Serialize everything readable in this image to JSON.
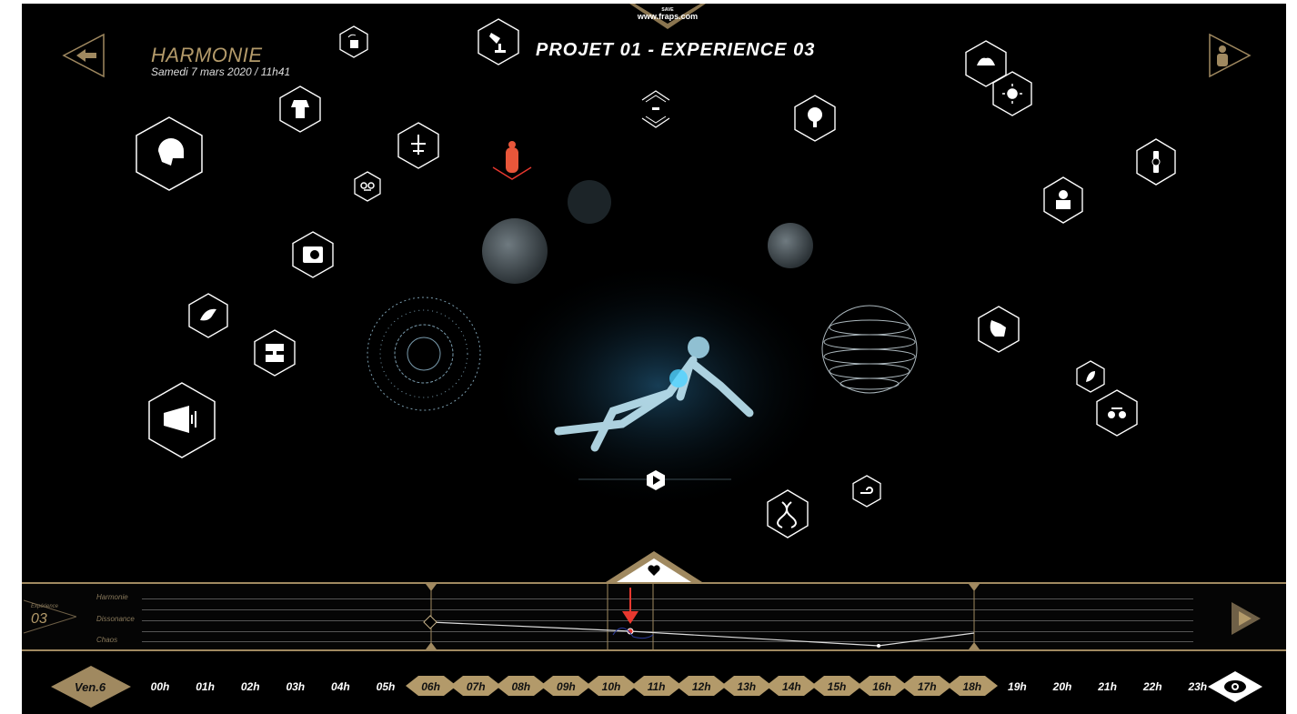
{
  "header": {
    "watermark": "www.fraps.com",
    "watermark_small": "SAVE",
    "app_title": "HARMONIE",
    "date": "Samedi 7 mars 2020 / 11h41",
    "project_title": "PROJET 01 - EXPERIENCE 03"
  },
  "icons": [
    {
      "name": "back-arrow-icon"
    },
    {
      "name": "profile-icon"
    },
    {
      "name": "wifi-device-icon"
    },
    {
      "name": "desk-lamp-icon"
    },
    {
      "name": "suit-icon"
    },
    {
      "name": "helmet-icon"
    },
    {
      "name": "antenna-icon"
    },
    {
      "name": "mask-icon"
    },
    {
      "name": "capsule-icon"
    },
    {
      "name": "minus-icon"
    },
    {
      "name": "camera-icon"
    },
    {
      "name": "bird-icon"
    },
    {
      "name": "stair-icon"
    },
    {
      "name": "megaphone-icon"
    },
    {
      "name": "tree-icon"
    },
    {
      "name": "lotus-icon"
    },
    {
      "name": "sun-icon"
    },
    {
      "name": "watch-icon"
    },
    {
      "name": "plant-pot-icon"
    },
    {
      "name": "squirrel-icon"
    },
    {
      "name": "leaf-icon"
    },
    {
      "name": "glasses-icon"
    },
    {
      "name": "wind-icon"
    },
    {
      "name": "dna-icon"
    },
    {
      "name": "play-icon"
    },
    {
      "name": "heart-icon"
    },
    {
      "name": "next-arrow-icon"
    },
    {
      "name": "eye-icon"
    }
  ],
  "timeline": {
    "experience_label": "Expérience",
    "experience_number": "03",
    "lanes": [
      "Harmonie",
      "Dissonance",
      "Chaos"
    ]
  },
  "hours": {
    "day_label": "Ven.6",
    "items": [
      {
        "label": "00h",
        "active": false
      },
      {
        "label": "01h",
        "active": false
      },
      {
        "label": "02h",
        "active": false
      },
      {
        "label": "03h",
        "active": false
      },
      {
        "label": "04h",
        "active": false
      },
      {
        "label": "05h",
        "active": false
      },
      {
        "label": "06h",
        "active": true
      },
      {
        "label": "07h",
        "active": true
      },
      {
        "label": "08h",
        "active": true
      },
      {
        "label": "09h",
        "active": true
      },
      {
        "label": "10h",
        "active": true
      },
      {
        "label": "11h",
        "active": true
      },
      {
        "label": "12h",
        "active": true
      },
      {
        "label": "13h",
        "active": true
      },
      {
        "label": "14h",
        "active": true
      },
      {
        "label": "15h",
        "active": true
      },
      {
        "label": "16h",
        "active": true
      },
      {
        "label": "17h",
        "active": true
      },
      {
        "label": "18h",
        "active": true
      },
      {
        "label": "19h",
        "active": false
      },
      {
        "label": "20h",
        "active": false
      },
      {
        "label": "21h",
        "active": false
      },
      {
        "label": "22h",
        "active": false
      },
      {
        "label": "23h",
        "active": false
      }
    ]
  },
  "colors": {
    "accent": "#b39a6a",
    "alert": "#e8382f",
    "background": "#000000"
  }
}
